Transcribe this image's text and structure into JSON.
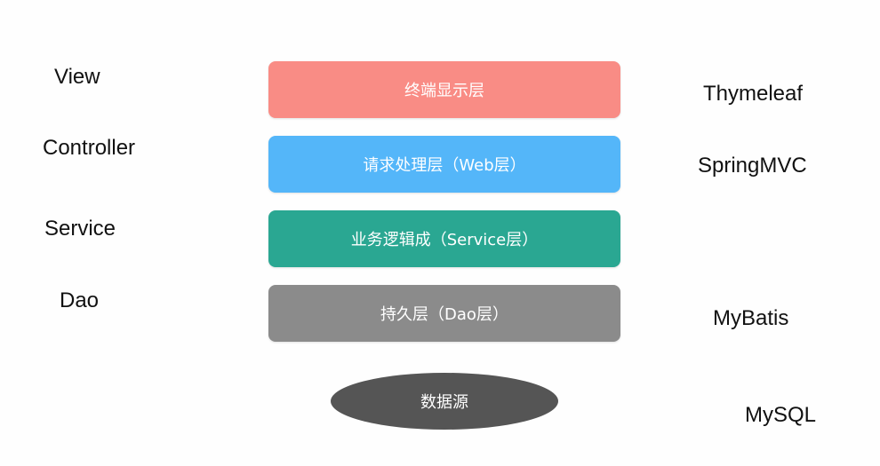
{
  "left_labels": [
    "View",
    "Controller",
    "Service",
    "Dao"
  ],
  "layers": [
    {
      "label": "终端显示层",
      "color": "#f98c85"
    },
    {
      "label": "请求处理层（Web层）",
      "color": "#54b6f9"
    },
    {
      "label": "业务逻辑成（Service层）",
      "color": "#2aa792"
    },
    {
      "label": "持久层（Dao层）",
      "color": "#8b8b8b"
    }
  ],
  "datasource": {
    "label": "数据源",
    "color": "#555555"
  },
  "right_labels": [
    "Thymeleaf",
    "SpringMVC",
    "MyBatis",
    "MySQL"
  ]
}
